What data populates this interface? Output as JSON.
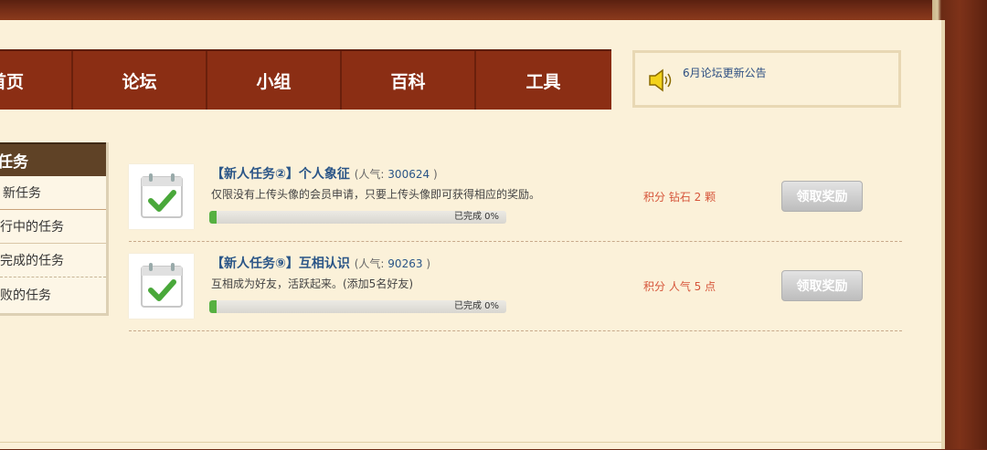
{
  "nav": {
    "items": [
      "首页",
      "论坛",
      "小组",
      "百科",
      "工具"
    ]
  },
  "notice": {
    "icon": "speaker-icon",
    "text": "6月论坛更新公告"
  },
  "sidebar": {
    "title": "任务",
    "items": [
      "新任务",
      "进行中的任务",
      "已完成的任务",
      "失败的任务"
    ]
  },
  "tasks": [
    {
      "icon": "calendar-check-icon",
      "title": "【新人任务②】个人象征",
      "pop_label": "(人气:",
      "pop_value": "300624",
      "pop_close": ")",
      "desc": "仅限没有上传头像的会员申请，只要上传头像即可获得相应的奖励。",
      "progress_text": "已完成 0%",
      "progress": 0.0,
      "reward": "积分 钻石 2 颗",
      "claim_label": "领取奖励"
    },
    {
      "icon": "calendar-check-icon",
      "title": "【新人任务⑨】互相认识",
      "pop_label": "(人气:",
      "pop_value": "90263",
      "pop_close": ")",
      "desc": "互相成为好友，活跃起来。(添加5名好友)",
      "progress_text": "已完成 0%",
      "progress": 0.0,
      "reward": "积分 人气 5 点",
      "claim_label": "领取奖励"
    }
  ],
  "colors": {
    "nav_bg": "#8b2e14",
    "link": "#2a5587",
    "reward": "#d6553a",
    "progress": "#56b041"
  }
}
